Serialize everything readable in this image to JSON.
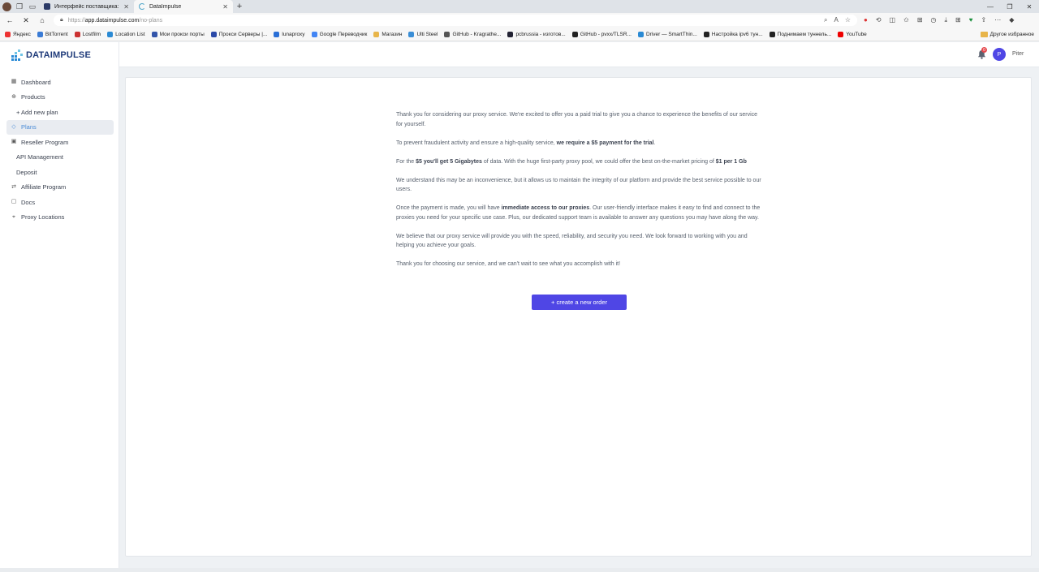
{
  "browser": {
    "tabs": [
      {
        "title": "Интерфейс поставщика: Buyer...",
        "active": false
      },
      {
        "title": "DataImpulse",
        "active": true
      }
    ],
    "url": "https://app.dataimpulse.com/no-plans",
    "url_prefix": "https://",
    "url_host": "app.dataimpulse.com",
    "url_path": "/no-plans",
    "bookmarks": [
      {
        "label": "Яндекс",
        "color": "#e33"
      },
      {
        "label": "BitTorrent",
        "color": "#3a7bd5"
      },
      {
        "label": "Lostfilm",
        "color": "#c33"
      },
      {
        "label": "Location List",
        "color": "#2a8ad4"
      },
      {
        "label": "Мои прокси порты",
        "color": "#3355aa"
      },
      {
        "label": "Прокси Серверы |...",
        "color": "#2b4aa8"
      },
      {
        "label": "lunaproxy",
        "color": "#2a6fd6"
      },
      {
        "label": "Google Переводчик",
        "color": "#4285f4"
      },
      {
        "label": "Магазин",
        "color": "#e8b54a"
      },
      {
        "label": "Ulti Steel",
        "color": "#3a8ed6"
      },
      {
        "label": "GitHub - Kragrathe...",
        "color": "#555"
      },
      {
        "label": "pcbrussia - изготов...",
        "color": "#223"
      },
      {
        "label": "GitHub - pvxx/TLSR...",
        "color": "#222"
      },
      {
        "label": "Driver — SmartThin...",
        "color": "#2a8ad4"
      },
      {
        "label": "Настройка ipv6 тун...",
        "color": "#222"
      },
      {
        "label": "Поднимаем туннель...",
        "color": "#222"
      },
      {
        "label": "YouTube",
        "color": "#e00"
      }
    ],
    "other_bookmarks": "Другое избранное"
  },
  "logo": {
    "text": "DATAIMPULSE"
  },
  "header": {
    "user_initial": "P",
    "user_name": "Piter",
    "notifications": "0"
  },
  "sidebar": {
    "items": [
      {
        "label": "Dashboard"
      },
      {
        "label": "Products"
      },
      {
        "label": "+ Add new plan"
      },
      {
        "label": "Plans"
      },
      {
        "label": "Reseller Program"
      },
      {
        "label": "API Management"
      },
      {
        "label": "Deposit"
      },
      {
        "label": "Affiliate Program"
      },
      {
        "label": "Docs"
      },
      {
        "label": "Proxy Locations"
      }
    ]
  },
  "main": {
    "p1": "Thank you for considering our proxy service. We're excited to offer you a paid trial to give you a chance to experience the benefits of our service for yourself.",
    "p2_a": "To prevent fraudulent activity and ensure a high-quality service, ",
    "p2_b": "we require a $5 payment for the trial",
    "p2_c": ".",
    "p3_a": "For the ",
    "p3_b": "$5 you'll get 5 Gigabytes",
    "p3_c": " of data. With the huge first-party proxy pool, we could offer the best on-the-market pricing of ",
    "p3_d": "$1 per 1 Gb",
    "p4": "We understand this may be an inconvenience, but it allows us to maintain the integrity of our platform and provide the best service possible to our users.",
    "p5_a": "Once the payment is made, you will have ",
    "p5_b": "immediate access to our proxies",
    "p5_c": ". Our user-friendly interface makes it easy to find and connect to the proxies you need for your specific use case. Plus, our dedicated support team is available to answer any questions you may have along the way.",
    "p6": "We believe that our proxy service will provide you with the speed, reliability, and security you need. We look forward to working with you and helping you achieve your goals.",
    "p7": "Thank you for choosing our service, and we can't wait to see what you accomplish with it!",
    "cta_label": "+ create a new order"
  },
  "colors": {
    "accent": "#4f46e5",
    "active_nav": "#4a8bd6",
    "logo": "#1f3b7a"
  }
}
